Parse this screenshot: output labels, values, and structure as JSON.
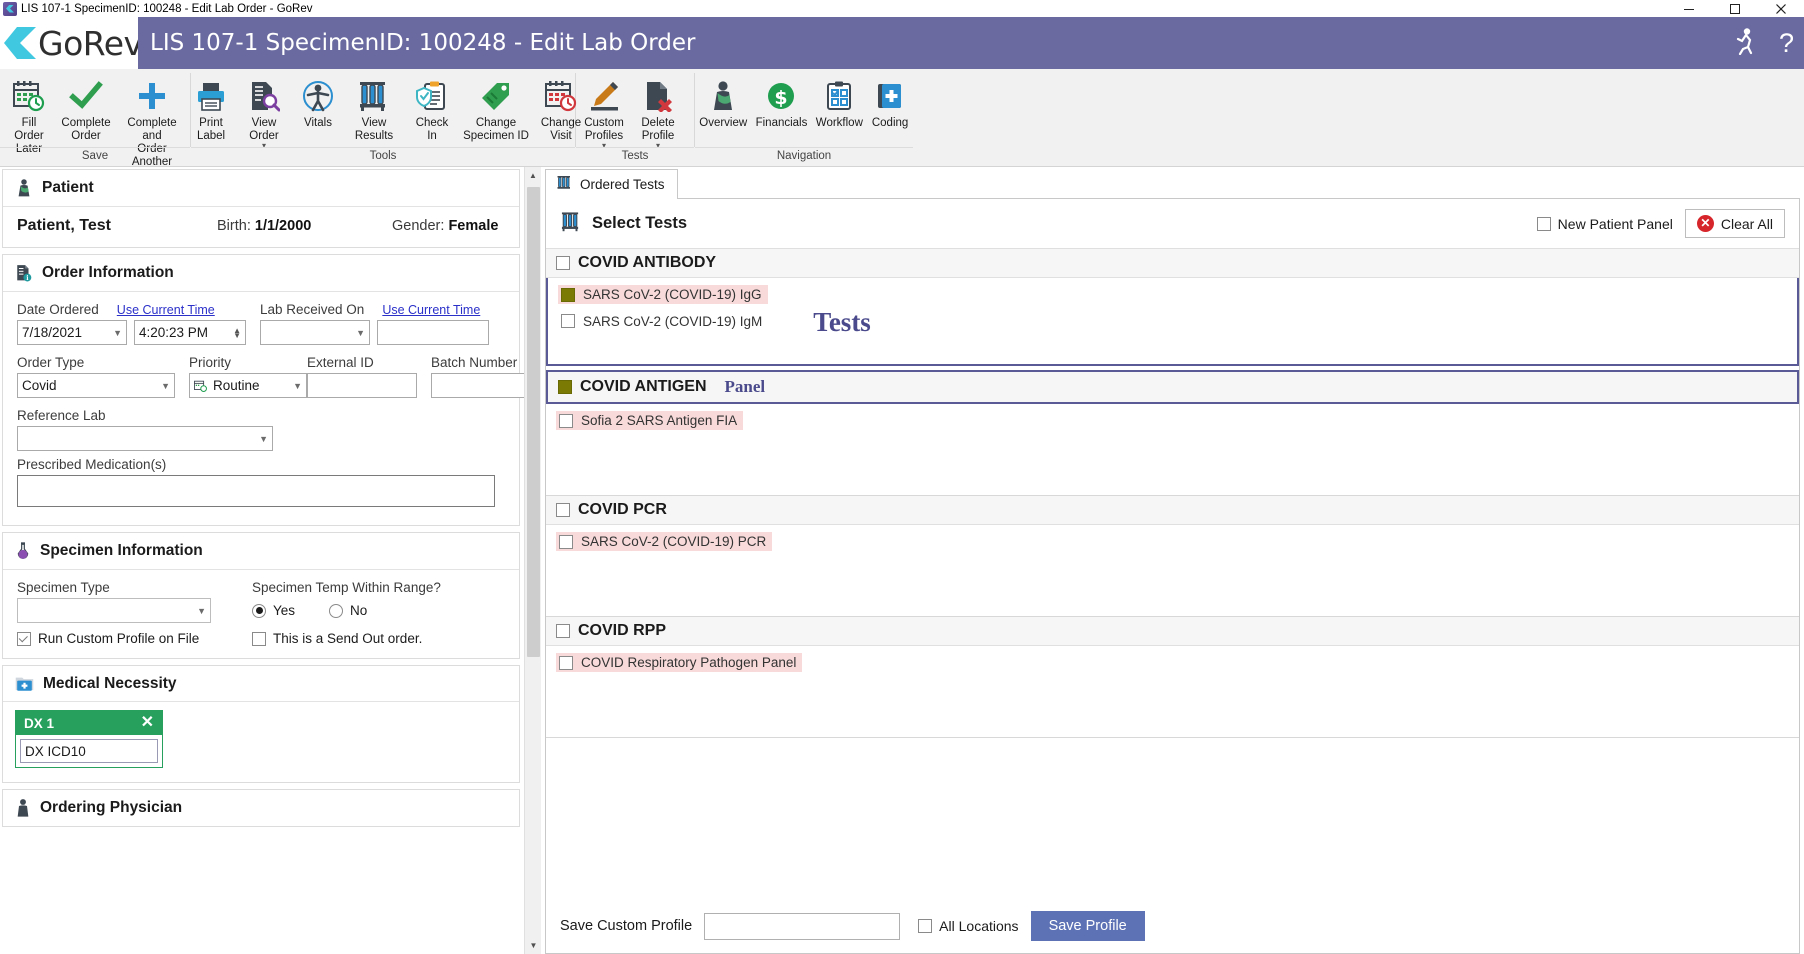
{
  "window": {
    "title": "LIS 107-1 SpecimenID: 100248 - Edit Lab Order - GoRev",
    "minimize_label": "—",
    "maximize_label": "❐",
    "close_label": "✕"
  },
  "app": {
    "brand": "GoRev",
    "header_title": "LIS 107-1 SpecimenID: 100248 - Edit Lab Order",
    "accent_color": "#6a6aa0",
    "help_icon": "question-mark-icon",
    "user_icon": "person-running-icon"
  },
  "ribbon": {
    "groups": [
      {
        "name": "Save",
        "label": "Save",
        "items": [
          {
            "icon": "calendar-clock-icon",
            "label": "Fill Order\nLater",
            "caret": false
          },
          {
            "icon": "green-check-icon",
            "label": "Complete\nOrder",
            "caret": false
          },
          {
            "icon": "blue-plus-icon",
            "label": "Complete and\nOrder Another",
            "caret": false
          }
        ]
      },
      {
        "name": "Tools",
        "label": "Tools",
        "items": [
          {
            "icon": "printer-icon",
            "label": "Print\nLabel",
            "caret": false
          },
          {
            "icon": "document-search-icon",
            "label": "View Order",
            "caret": true
          },
          {
            "icon": "vitals-person-icon",
            "label": "Vitals",
            "caret": false
          },
          {
            "icon": "test-tubes-icon",
            "label": "View Results",
            "caret": false
          },
          {
            "icon": "clipboard-shield-icon",
            "label": "Check\nIn",
            "caret": false
          },
          {
            "icon": "green-tag-icon",
            "label": "Change\nSpecimen ID",
            "caret": false
          },
          {
            "icon": "calendar-clock-red-icon",
            "label": "Change\nVisit",
            "caret": false
          }
        ]
      },
      {
        "name": "Tests",
        "label": "Tests",
        "items": [
          {
            "icon": "pencil-edit-icon",
            "label": "Custom\nProfiles",
            "caret": true
          },
          {
            "icon": "document-delete-icon",
            "label": "Delete\nProfile",
            "caret": true
          }
        ]
      },
      {
        "name": "Navigation",
        "label": "Navigation",
        "items": [
          {
            "icon": "patient-sling-icon",
            "label": "Overview",
            "caret": false
          },
          {
            "icon": "dollar-circle-icon",
            "label": "Financials",
            "caret": false
          },
          {
            "icon": "clipboard-checklist-icon",
            "label": "Workflow",
            "caret": false
          },
          {
            "icon": "coding-book-icon",
            "label": "Coding",
            "caret": false
          }
        ]
      }
    ]
  },
  "left": {
    "patient_card": {
      "title": "Patient",
      "icon": "patient-sling-icon",
      "name": "Patient, Test",
      "birth_label": "Birth:",
      "birth_value": "1/1/2000",
      "gender_label": "Gender:",
      "gender_value": "Female"
    },
    "order_card": {
      "title": "Order Information",
      "icon": "order-info-icon",
      "date_ordered_label": "Date Ordered",
      "date_ordered_link": "Use Current Time",
      "date_ordered_value": "7/18/2021",
      "time_ordered_value": "4:20:23 PM",
      "lab_received_label": "Lab Received On",
      "lab_received_link": "Use Current Time",
      "lab_received_date_value": "",
      "lab_received_time_value": "",
      "order_type_label": "Order Type",
      "order_type_value": "Covid",
      "priority_label": "Priority",
      "priority_value": "Routine",
      "priority_icon": "calendar-clock-icon",
      "external_id_label": "External ID",
      "external_id_value": "",
      "batch_number_label": "Batch Number",
      "batch_number_value": "",
      "reference_lab_label": "Reference Lab",
      "reference_lab_value": "",
      "prescribed_med_label": "Prescribed Medication(s)",
      "prescribed_med_value": ""
    },
    "specimen_card": {
      "title": "Specimen Information",
      "icon": "flask-icon",
      "specimen_type_label": "Specimen Type",
      "specimen_type_value": "",
      "temp_in_range_label": "Specimen Temp Within Range?",
      "temp_yes_label": "Yes",
      "temp_no_label": "No",
      "temp_selected": "Yes",
      "run_custom_profile_label": "Run Custom Profile on File",
      "run_custom_profile_checked": true,
      "send_out_label": "This is a Send Out order.",
      "send_out_checked": false
    },
    "medical_necessity_card": {
      "title": "Medical Necessity",
      "icon": "folder-plus-icon",
      "dx_label": "DX 1",
      "dx_remove": "✕",
      "dx_value": "DX ICD10"
    },
    "ordering_physician_card": {
      "title": "Ordering Physician",
      "icon": "physician-icon"
    }
  },
  "right": {
    "tab": {
      "label": "Ordered Tests",
      "icon": "test-tubes-icon"
    },
    "panel_title": "Select Tests",
    "panel_icon": "test-tubes-icon",
    "new_patient_panel_label": "New Patient Panel",
    "new_patient_panel_checked": false,
    "clear_all_label": "Clear All",
    "clear_all_icon": "red-x-circle-icon",
    "annotations": {
      "tests": "Tests",
      "panel": "Panel"
    },
    "groups": [
      {
        "name": "COVID ANTIBODY",
        "checked": false,
        "fill": "none",
        "selected": true,
        "annotation": "",
        "tests": [
          {
            "label": "SARS CoV-2 (COVID-19) IgG",
            "checked": true,
            "fill": "olive"
          },
          {
            "label": "SARS CoV-2 (COVID-19) IgM",
            "checked": false,
            "fill": "none"
          }
        ]
      },
      {
        "name": "COVID ANTIGEN",
        "checked": true,
        "fill": "olive",
        "selected": true,
        "annotation": "Panel",
        "tests": [
          {
            "label": "Sofia 2 SARS Antigen FIA",
            "checked": false,
            "fill": "none"
          }
        ]
      },
      {
        "name": "COVID PCR",
        "checked": false,
        "fill": "none",
        "selected": false,
        "annotation": "",
        "tests": [
          {
            "label": "SARS CoV-2 (COVID-19) PCR",
            "checked": false,
            "fill": "none"
          }
        ]
      },
      {
        "name": "COVID RPP",
        "checked": false,
        "fill": "none",
        "selected": false,
        "annotation": "",
        "tests": [
          {
            "label": "COVID Respiratory Pathogen Panel",
            "checked": false,
            "fill": "none"
          }
        ]
      }
    ],
    "footer": {
      "save_custom_profile_label": "Save Custom Profile",
      "save_custom_profile_value": "",
      "all_locations_label": "All Locations",
      "all_locations_checked": false,
      "save_profile_button": "Save Profile",
      "button_color": "#5d72b5"
    }
  }
}
